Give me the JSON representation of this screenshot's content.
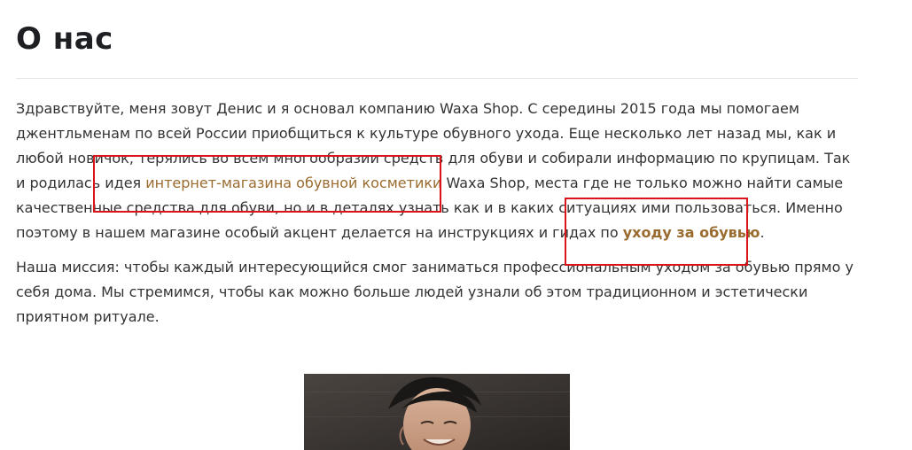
{
  "page": {
    "title": "О нас"
  },
  "about": {
    "paragraph1": {
      "text_start": "Здравствуйте, меня зовут Денис и я основал компанию Waxa Shop. С середины 2015 года мы помогаем джентльменам по всей России приобщиться к культуре обувного ухода. Еще несколько лет назад мы, как и любой новичок, терялись во всем многообразии средств для обуви и собирали информацию по крупицам. Так и родилась идея ",
      "link1_text": "интернет-магазина обувной косметики",
      "text_middle": " Waxa Shop, места где не только можно найти самые качественные средства для обуви, но и в деталях узнать как и в каких ситуациях ими пользоваться. Именно поэтому в нашем магазине особый акцент делается на инструкциях и гидах по ",
      "link2_text": "уходу за обувью",
      "text_end": "."
    },
    "paragraph2": "Наша миссия: чтобы каждый интересующийся смог заниматься профессиональным уходом за обувью прямо у себя дома. Мы стремимся, чтобы как можно больше людей узнали об этом традиционном и эстетически приятном ритуале."
  },
  "colors": {
    "link": "#9a6b2f",
    "highlight_box": "#d9141b",
    "title": "#1d1f22",
    "text": "#333333"
  }
}
